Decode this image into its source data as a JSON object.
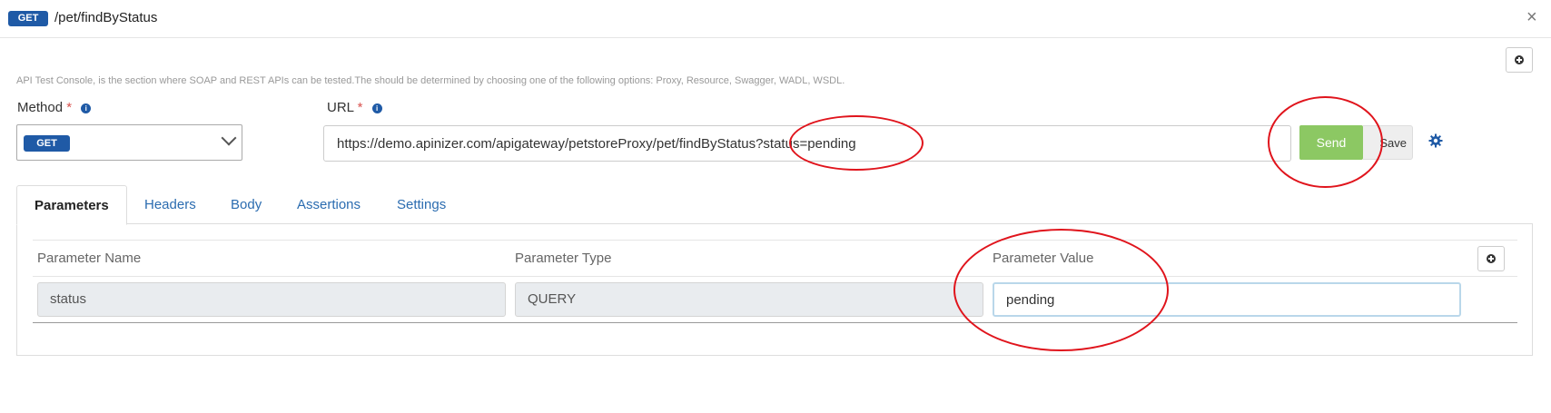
{
  "header": {
    "method": "GET",
    "path": "/pet/findByStatus",
    "close_glyph": "×"
  },
  "description": "API Test Console, is the section where SOAP and REST APIs can be tested.The should be determined by choosing one of the following options: Proxy, Resource, Swagger, WADL, WSDL.",
  "method_field": {
    "label": "Method",
    "required_mark": "*",
    "selected": "GET"
  },
  "url_field": {
    "label": "URL",
    "required_mark": "*",
    "value": "https://demo.apinizer.com/apigateway/petstoreProxy/pet/findByStatus?status=pending"
  },
  "actions": {
    "send_label": "Send",
    "save_label": "Save"
  },
  "tabs": [
    {
      "label": "Parameters",
      "active": true
    },
    {
      "label": "Headers",
      "active": false
    },
    {
      "label": "Body",
      "active": false
    },
    {
      "label": "Assertions",
      "active": false
    },
    {
      "label": "Settings",
      "active": false
    }
  ],
  "parameters_table": {
    "columns": [
      "Parameter Name",
      "Parameter Type",
      "Parameter Value"
    ],
    "rows": [
      {
        "name": "status",
        "type": "QUERY",
        "value": "pending"
      }
    ]
  },
  "icons": {
    "info": "info-icon",
    "gear": "gear-icon",
    "add": "plus-circle-icon",
    "close": "close-icon",
    "chevron": "chevron-down-icon"
  },
  "colors": {
    "method_badge": "#1f5aa6",
    "send_button": "#8cc863",
    "annotation_ellipse": "#e0141c",
    "link": "#2b6cb0"
  }
}
